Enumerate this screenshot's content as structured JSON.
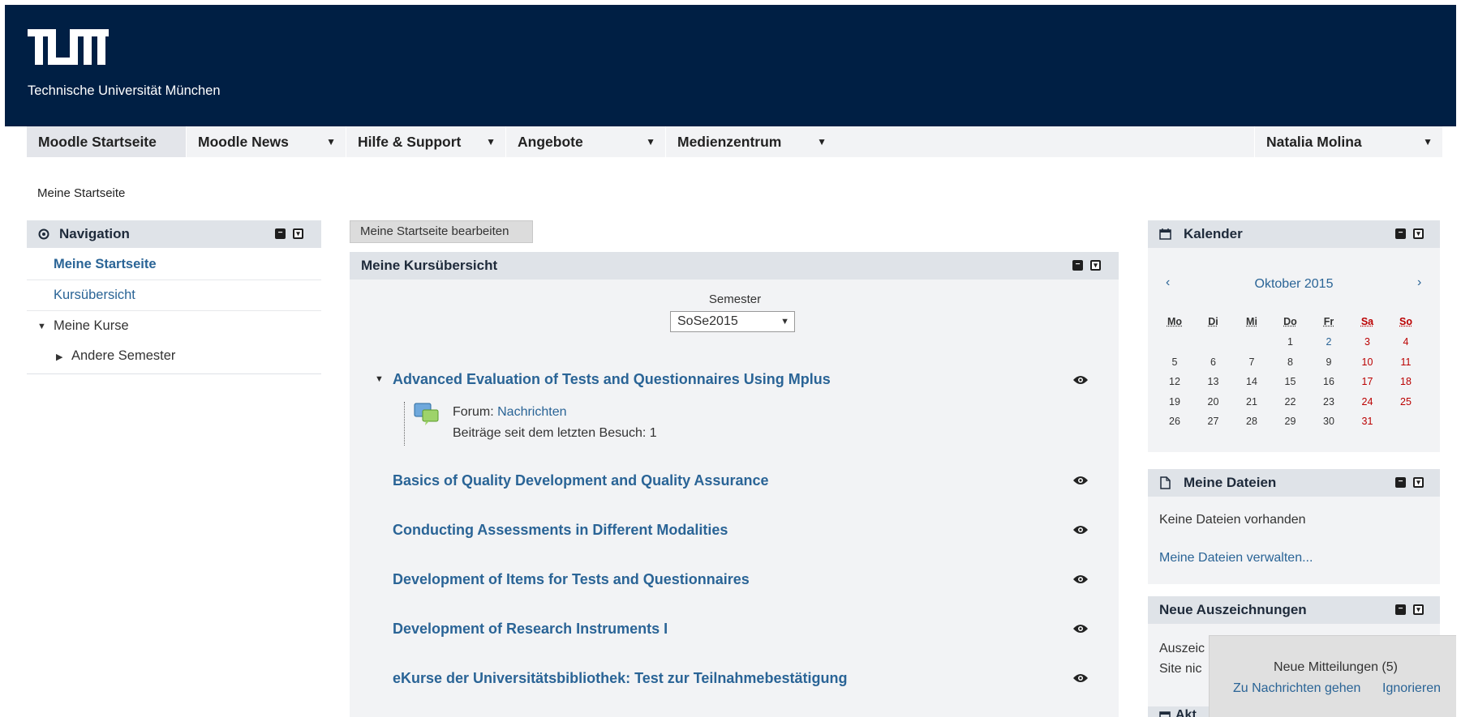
{
  "header": {
    "logo_text": "TUM",
    "subtitle": "Technische Universität München"
  },
  "navbar": {
    "items": [
      {
        "label": "Moodle Startseite"
      },
      {
        "label": "Moodle News"
      },
      {
        "label": "Hilfe & Support"
      },
      {
        "label": "Angebote"
      },
      {
        "label": "Medienzentrum"
      }
    ],
    "user": "Natalia Molina"
  },
  "breadcrumb": "Meine Startseite",
  "navigation": {
    "title": "Navigation",
    "items": [
      "Meine Startseite",
      "Kursübersicht",
      "Meine Kurse",
      "Andere Semester"
    ]
  },
  "main": {
    "edit_button": "Meine Startseite bearbeiten",
    "title": "Meine Kursübersicht",
    "semester_label": "Semester",
    "semester_value": "SoSe2015",
    "courses": [
      "Advanced Evaluation of Tests and Questionnaires Using Mplus",
      "Basics of Quality Development and Quality Assurance",
      "Conducting Assessments in Different Modalities",
      "Development of Items for Tests and Questionnaires",
      "Development of Research Instruments I",
      "eKurse der Universitätsbibliothek: Test zur Teilnahmebestätigung"
    ],
    "forum": {
      "prefix": "Forum:",
      "name": "Nachrichten",
      "posts": "Beiträge seit dem letzten Besuch: 1"
    }
  },
  "calendar": {
    "title": "Kalender",
    "month": "Oktober 2015",
    "prev": "‹",
    "next": "›",
    "weekdays": [
      "Mo",
      "Di",
      "Mi",
      "Do",
      "Fr",
      "Sa",
      "So"
    ],
    "weeks": [
      [
        "",
        "",
        "",
        "1",
        "2",
        "3",
        "4"
      ],
      [
        "5",
        "6",
        "7",
        "8",
        "9",
        "10",
        "11"
      ],
      [
        "12",
        "13",
        "14",
        "15",
        "16",
        "17",
        "18"
      ],
      [
        "19",
        "20",
        "21",
        "22",
        "23",
        "24",
        "25"
      ],
      [
        "26",
        "27",
        "28",
        "29",
        "30",
        "31",
        ""
      ]
    ]
  },
  "files": {
    "title": "Meine Dateien",
    "empty": "Keine Dateien vorhanden",
    "manage": "Meine Dateien verwalten..."
  },
  "badges": {
    "title": "Neue Auszeichnungen",
    "line1": "Auszeic",
    "line2": "Site nic"
  },
  "next_block": {
    "title_fragment": "Akt"
  },
  "popup": {
    "title": "Neue Mitteilungen (5)",
    "go": "Zu Nachrichten gehen",
    "ignore": "Ignorieren"
  },
  "colors": {
    "header_bg": "#001f44",
    "link": "#2a6496",
    "block_head": "#dfe3e8",
    "weekend": "#b00000"
  }
}
